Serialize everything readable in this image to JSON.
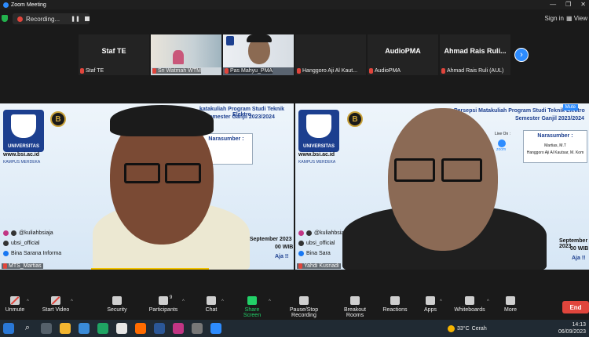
{
  "window": {
    "title": "Zoom Meeting"
  },
  "topbar": {
    "recording_label": "Recording...",
    "signin_label": "Sign in",
    "view_label": "View"
  },
  "participants_strip": [
    {
      "name_display": "Staf TE",
      "label": "Staf TE",
      "type": "name"
    },
    {
      "name_display": "",
      "label": "Sri Watmah WTM",
      "type": "video"
    },
    {
      "name_display": "",
      "label": "Pas Mahyu_PMA",
      "type": "video"
    },
    {
      "name_display": "",
      "label": "Hanggoro Aji Al Kaut...",
      "type": "blank"
    },
    {
      "name_display": "AudioPMA",
      "label": "AudioPMA",
      "type": "name"
    },
    {
      "name_display": "Ahmad Rais Ruli...",
      "label": "Ahmad Rais Ruli (AUL)",
      "type": "name"
    }
  ],
  "videos": [
    {
      "label": "MTS_Martias",
      "univ_name": "UNIVERSITAS",
      "site": "www.bsi.ac.id",
      "title_line1": "katakuliah Program Studi Teknik Elektro",
      "title_line2": "Semester Ganjil 2023/2024",
      "speaker_header": "Narasumber :",
      "speaker1": "",
      "speaker2": "",
      "socials": [
        "@kuliahbsiaja",
        "ubsi_official",
        "Bina Sarana Informa"
      ],
      "date": "6 September 2023",
      "time": "00 WIB",
      "tagline": "Aja !!"
    },
    {
      "label": "Yahdi Kusnadi",
      "univ_name": "UNIVERSITAS",
      "site": "www.bsi.ac.id",
      "title_line1": "Persepsi Matakuliah Program Studi Teknik Elektro",
      "title_line2": "Semester Ganjil 2023/2024",
      "speaker_header": "Narasumber :",
      "speaker1": "Martias, M.T",
      "speaker2": "Hanggoro Aji Al Kautsar, M. Kom",
      "live_on": "Live On :",
      "zoom_word": "zoom",
      "socials": [
        "@kuliahbsiaja",
        "ubsi_official",
        "Bina Sara"
      ],
      "date": "September 2023",
      "time": "00 WIB",
      "tagline": "Aja !!",
      "mute_tag": "Mute"
    }
  ],
  "toolbar": {
    "items": [
      {
        "label": "Unmute",
        "icon": "mic-muted-icon"
      },
      {
        "label": "Start Video",
        "icon": "video-off-icon"
      },
      {
        "label": "Security",
        "icon": "shield-icon"
      },
      {
        "label": "Participants",
        "icon": "participants-icon",
        "count": "9"
      },
      {
        "label": "Chat",
        "icon": "chat-icon"
      },
      {
        "label": "Share Screen",
        "icon": "share-screen-icon"
      },
      {
        "label": "Pause/Stop Recording",
        "icon": "recording-icon"
      },
      {
        "label": "Breakout Rooms",
        "icon": "breakout-icon"
      },
      {
        "label": "Reactions",
        "icon": "reactions-icon"
      },
      {
        "label": "Apps",
        "icon": "apps-icon"
      },
      {
        "label": "Whiteboards",
        "icon": "whiteboard-icon"
      },
      {
        "label": "More",
        "icon": "more-icon"
      }
    ],
    "end_label": "End"
  },
  "taskbar": {
    "weather_temp": "33°C",
    "weather_desc": "Cerah",
    "time": "14:13",
    "date": "06/09/2023"
  },
  "colors": {
    "accent": "#2d8cff",
    "end": "#e0453c",
    "share": "#22d168"
  }
}
